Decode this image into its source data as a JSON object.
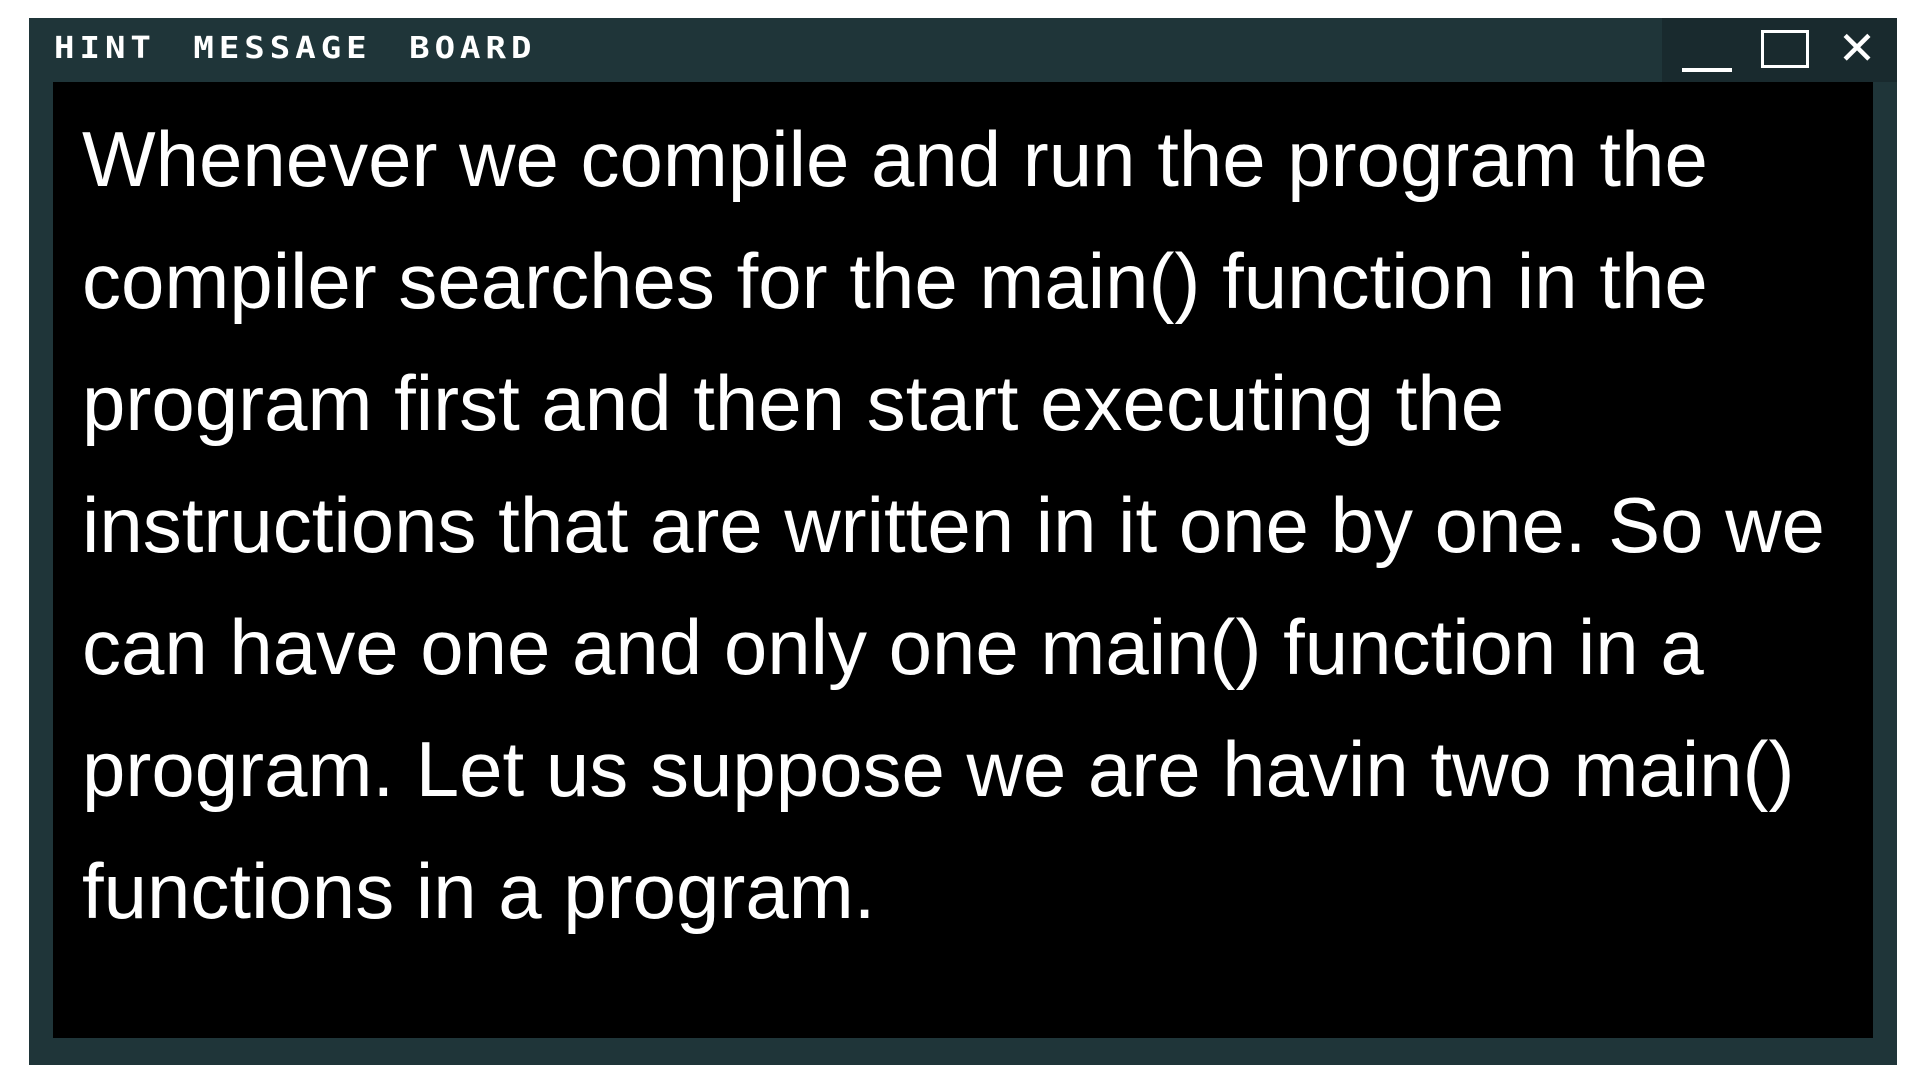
{
  "window": {
    "title": "Hint Message Board",
    "controls": {
      "minimize_icon": "minimize-icon",
      "maximize_icon": "maximize-icon",
      "close_icon": "close-icon",
      "close_glyph": "✕"
    }
  },
  "message": {
    "text": "Whenever we compile and run the program the compiler searches for the main() function in the program first and then start executing the instructions that are written in it one by one. So we can have one and only one main() function in a program. Let us suppose we are havin two main() functions in a program."
  },
  "colors": {
    "frame": "#1f3539",
    "controls_bg": "#192a2e",
    "content_bg": "#000000",
    "text": "#ffffff"
  }
}
